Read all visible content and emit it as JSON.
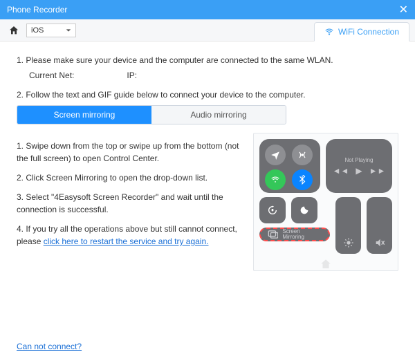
{
  "window": {
    "title": "Phone Recorder"
  },
  "toolbar": {
    "os_selected": "iOS",
    "wifi_tab": "WiFi Connection"
  },
  "steps": {
    "s1": "1. Please make sure your device and the computer are connected to the same WLAN.",
    "current_net_label": "Current Net:",
    "current_net_value": "",
    "ip_label": "IP:",
    "ip_value": "",
    "s2": "2. Follow the text and GIF guide below to connect your device to the computer."
  },
  "tabs": {
    "mirror": "Screen mirroring",
    "audio": "Audio mirroring"
  },
  "instructions": {
    "i1": "1. Swipe down from the top or swipe up from the bottom (not the full screen) to open Control Center.",
    "i2": "2. Click Screen Mirroring to open the drop-down list.",
    "i3": "3. Select \"4Easysoft Screen Recorder\" and wait until the connection is successful.",
    "i4a": "4. If you try all the operations above but still cannot connect, please ",
    "i4b": "click here to restart the service and try again."
  },
  "control_center": {
    "not_playing": "Not Playing",
    "screen_mirroring": "Screen Mirroring"
  },
  "footer": {
    "cant_connect": "Can not connect?"
  }
}
